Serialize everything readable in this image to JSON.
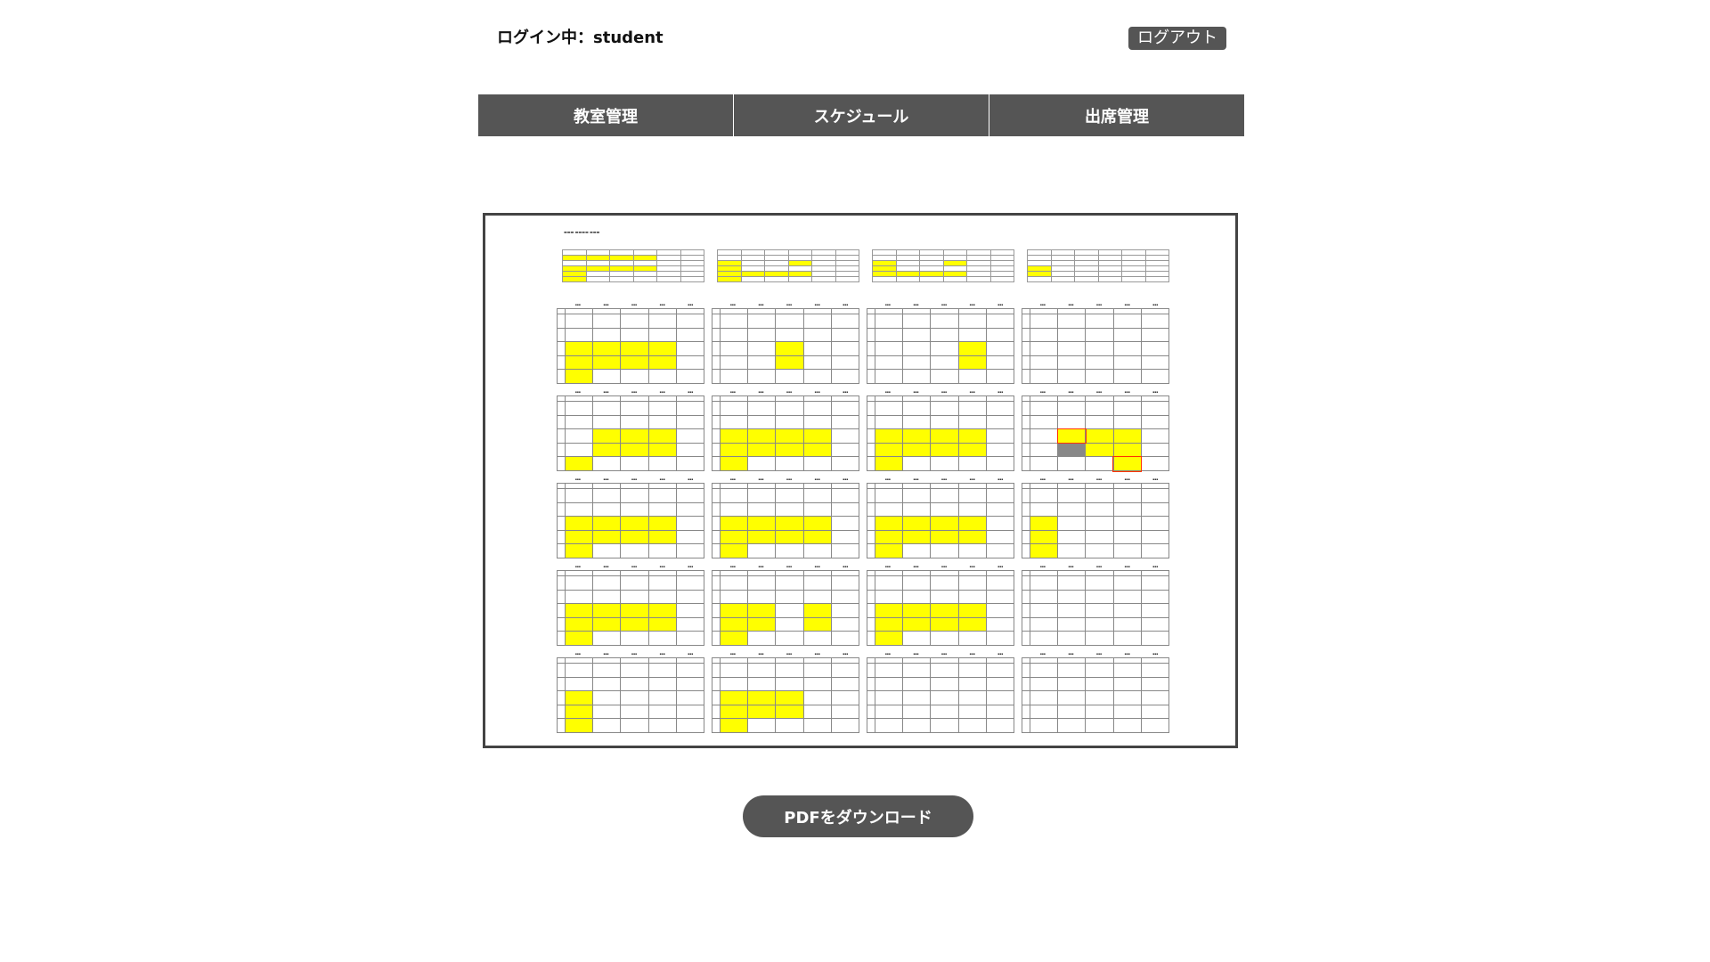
{
  "header": {
    "login_status": "ログイン中：student",
    "logout_label": "ログアウト"
  },
  "nav": {
    "items": [
      {
        "label": "教室管理"
      },
      {
        "label": "スケジュール"
      },
      {
        "label": "出席管理"
      }
    ]
  },
  "actions": {
    "pdf_download_label": "PDFをダウンロード"
  },
  "colors": {
    "nav_background": "#555555",
    "highlight": "#ffff00"
  }
}
